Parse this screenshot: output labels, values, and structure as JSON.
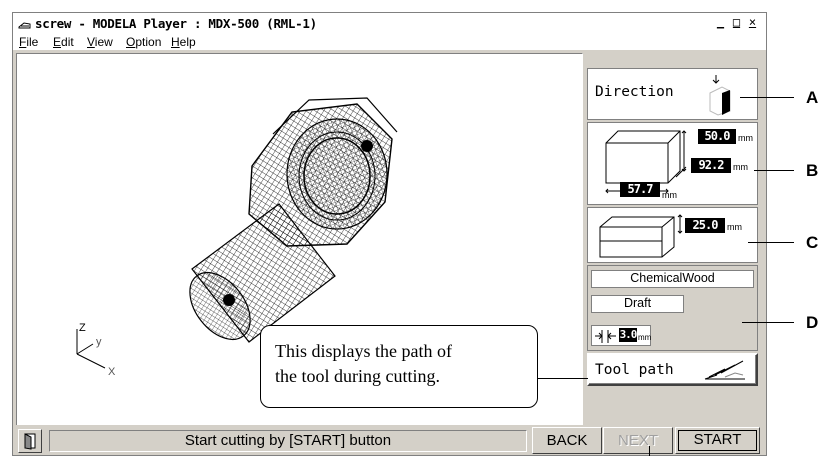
{
  "window": {
    "title": "screw - MODELA Player  : MDX-500 (RML-1)",
    "controls": {
      "minimize": "_",
      "maximize": "□",
      "close": "×"
    }
  },
  "menu": [
    {
      "label": "File",
      "mnemonic": "F",
      "rest": "ile"
    },
    {
      "label": "Edit",
      "mnemonic": "E",
      "rest": "dit"
    },
    {
      "label": "View",
      "mnemonic": "V",
      "rest": "iew"
    },
    {
      "label": "Option",
      "mnemonic": "O",
      "rest": "ption"
    },
    {
      "label": "Help",
      "mnemonic": "H",
      "rest": "elp"
    }
  ],
  "viewport": {
    "model": "wireframe screw",
    "axes": {
      "x": "X",
      "y": "y",
      "z": "Z"
    }
  },
  "panel": {
    "direction": {
      "label": "Direction"
    },
    "size": {
      "height": "50.0",
      "depth": "92.2",
      "width": "57.7",
      "unit": "mm"
    },
    "stock": {
      "thickness": "25.0",
      "unit": "mm"
    },
    "material": {
      "name": "ChemicalWood",
      "quality": "Draft",
      "tool_dia": "3.0",
      "unit": "mm"
    },
    "toolpath": {
      "label": "Tool path"
    }
  },
  "status": {
    "message": "Start cutting by [START] button",
    "buttons": {
      "back": "BACK",
      "next": "NEXT",
      "start": "START"
    }
  },
  "callouts": {
    "letters": [
      "A",
      "B",
      "C",
      "D"
    ],
    "tooltip_line1": "This displays the path of",
    "tooltip_line2": "the tool during cutting."
  },
  "colors": {
    "face": "#d4d0c8",
    "disabled": "#a0a0a0"
  }
}
